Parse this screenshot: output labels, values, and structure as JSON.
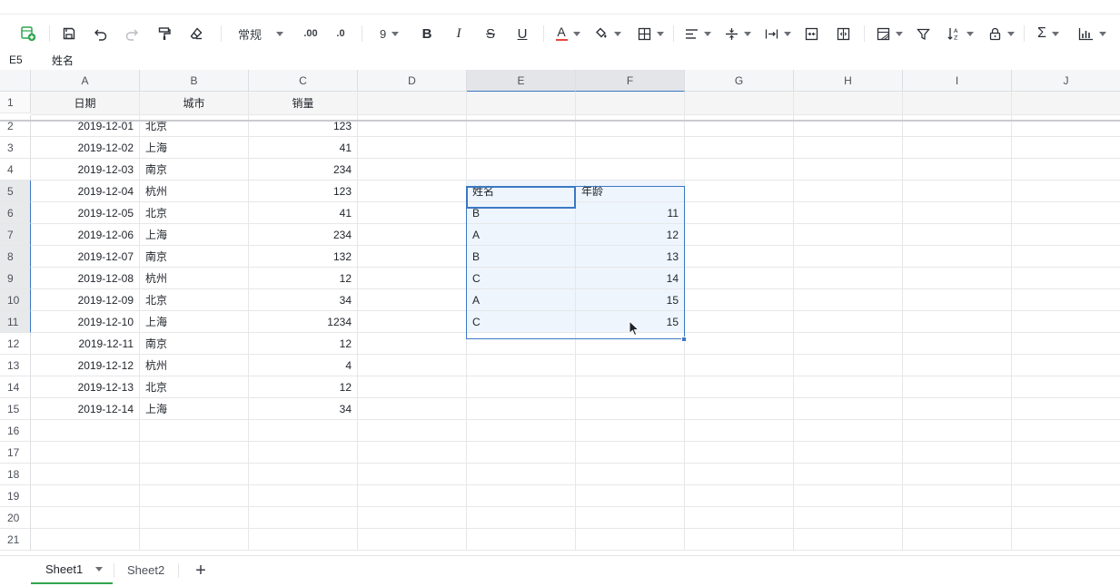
{
  "toolbar": {
    "number_format": "常规",
    "font_size": "9",
    "bold_label": "B",
    "italic_label": "I",
    "strike_label": "S",
    "underline_label": "U",
    "font_color_label": "A",
    "sum_label": "Σ",
    "decrease_decimal_label": ".00",
    "increase_decimal_label": ".0",
    "font_color": "#e8473f",
    "icons": [
      "new-sheet-icon",
      "save-icon",
      "undo-icon",
      "redo-icon",
      "format-painter-icon",
      "clear-format-icon",
      "fill-color-icon",
      "borders-icon",
      "align-icon",
      "vertical-align-icon",
      "wrap-icon",
      "merge-icon",
      "unmerge-icon",
      "conditional-format-icon",
      "filter-icon",
      "sort-icon",
      "lock-icon",
      "sum-icon",
      "chart-icon"
    ]
  },
  "formula_bar": {
    "cell_ref": "E5",
    "content": "姓名"
  },
  "grid": {
    "columns": [
      "A",
      "B",
      "C",
      "D",
      "E",
      "F",
      "G",
      "H",
      "I",
      "J"
    ],
    "rows": [
      "1",
      "2",
      "3",
      "4",
      "5",
      "6",
      "7",
      "8",
      "9",
      "10",
      "11",
      "12",
      "13",
      "14",
      "15",
      "16",
      "17",
      "18",
      "19",
      "20",
      "21"
    ],
    "header_row": [
      "日期",
      "城市",
      "销量"
    ],
    "data": [
      [
        "2019-12-01",
        "北京",
        "123"
      ],
      [
        "2019-12-02",
        "上海",
        "41"
      ],
      [
        "2019-12-03",
        "南京",
        "234"
      ],
      [
        "2019-12-04",
        "杭州",
        "123"
      ],
      [
        "2019-12-05",
        "北京",
        "41"
      ],
      [
        "2019-12-06",
        "上海",
        "234"
      ],
      [
        "2019-12-07",
        "南京",
        "132"
      ],
      [
        "2019-12-08",
        "杭州",
        "12"
      ],
      [
        "2019-12-09",
        "北京",
        "34"
      ],
      [
        "2019-12-10",
        "上海",
        "1234"
      ],
      [
        "2019-12-11",
        "南京",
        "12"
      ],
      [
        "2019-12-12",
        "杭州",
        "4"
      ],
      [
        "2019-12-13",
        "北京",
        "12"
      ],
      [
        "2019-12-14",
        "上海",
        "34"
      ]
    ],
    "side_table": {
      "headers": [
        "姓名",
        "年龄"
      ],
      "rows": [
        [
          "B",
          "11"
        ],
        [
          "A",
          "12"
        ],
        [
          "B",
          "13"
        ],
        [
          "C",
          "14"
        ],
        [
          "A",
          "15"
        ],
        [
          "C",
          "15"
        ]
      ]
    },
    "selected_columns": [
      "E",
      "F"
    ],
    "selected_rows": [
      "5",
      "6",
      "7",
      "8",
      "9",
      "10",
      "11"
    ],
    "selection_color": "#3b78c3"
  },
  "sheets": {
    "tabs": [
      "Sheet1",
      "Sheet2"
    ],
    "active": "Sheet1",
    "active_color": "#2fa44f",
    "add_label": "+"
  }
}
